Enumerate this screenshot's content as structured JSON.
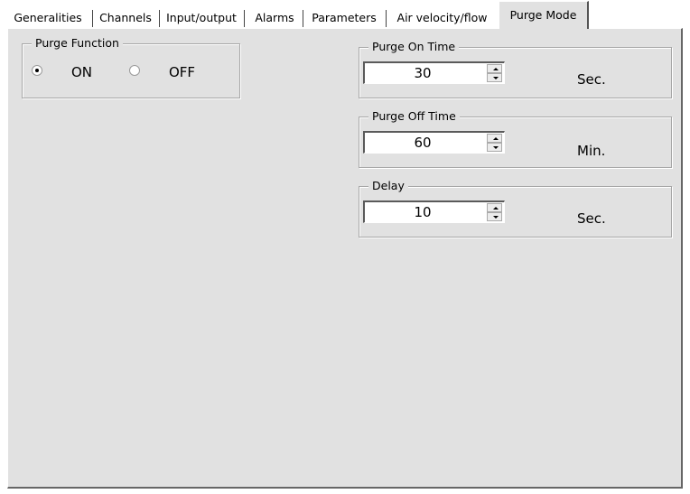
{
  "tabs": [
    {
      "label": "Generalities"
    },
    {
      "label": "Channels"
    },
    {
      "label": "Input/output"
    },
    {
      "label": "Alarms"
    },
    {
      "label": "Parameters"
    },
    {
      "label": "Air velocity/flow"
    },
    {
      "label": "Purge Mode",
      "active": true
    }
  ],
  "purge_function": {
    "title": "Purge Function",
    "options": [
      {
        "label": "ON",
        "selected": true
      },
      {
        "label": "OFF",
        "selected": false
      }
    ]
  },
  "purge_on_time": {
    "title": "Purge On Time",
    "value": "30",
    "unit": "Sec."
  },
  "purge_off_time": {
    "title": "Purge Off Time",
    "value": "60",
    "unit": "Min."
  },
  "delay": {
    "title": "Delay",
    "value": "10",
    "unit": "Sec."
  }
}
